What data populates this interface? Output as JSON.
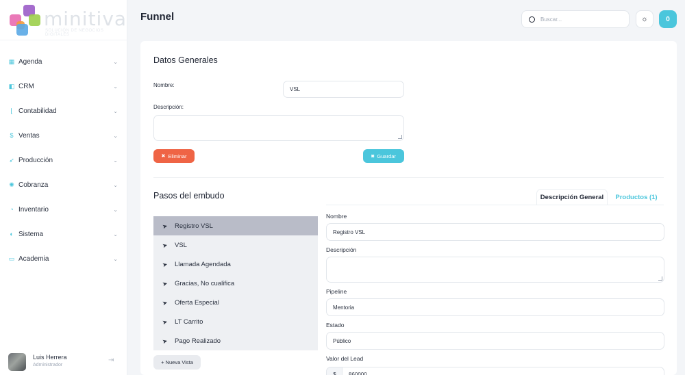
{
  "brand": {
    "name": "minitiva",
    "tagline": "SOLUCIÓN DE NEGOCIOS DIGITALES",
    "colors": {
      "purple": "#9b5cc8",
      "pink": "#e86ab0",
      "green": "#9ccf4a",
      "orange": "#f19a3e",
      "blue": "#5aa9e6"
    }
  },
  "sidebar": {
    "items": [
      {
        "label": "Agenda",
        "icon": "calendar-icon",
        "glyph": "▦",
        "color": "#4bc6dc"
      },
      {
        "label": "CRM",
        "icon": "book-icon",
        "glyph": "◧",
        "color": "#4bc6dc"
      },
      {
        "label": "Contabilidad",
        "icon": "chart-line-icon",
        "glyph": "⌊",
        "color": "#4bc6dc"
      },
      {
        "label": "Ventas",
        "icon": "dollar-icon",
        "glyph": "$",
        "color": "#4bc6dc"
      },
      {
        "label": "Producción",
        "icon": "rocket-icon",
        "glyph": "➶",
        "color": "#4bc6dc"
      },
      {
        "label": "Cobranza",
        "icon": "atom-icon",
        "glyph": "✺",
        "color": "#4bc6dc"
      },
      {
        "label": "Inventario",
        "icon": "spinner-icon",
        "glyph": "◔",
        "color": "#4bc6dc"
      },
      {
        "label": "Sistema",
        "icon": "settings-icon",
        "glyph": "◐",
        "color": "#4bc6dc"
      },
      {
        "label": "Academia",
        "icon": "laptop-icon",
        "glyph": "▭",
        "color": "#4bc6dc"
      }
    ],
    "user": {
      "name": "Luis Herrera",
      "role": "Administrador"
    }
  },
  "header": {
    "title": "Funnel",
    "search_placeholder": "Buscar...",
    "notification_count": "0",
    "accent": "#4bc6dc"
  },
  "general": {
    "heading": "Datos Generales",
    "name_label": "Nombre:",
    "name_value": "VSL",
    "description_label": "Descripción:",
    "delete_label": "Eliminar",
    "save_label": "Guardar",
    "delete_color": "#ef6445"
  },
  "steps": {
    "heading": "Pasos del embudo",
    "items": [
      "Registro VSL",
      "VSL",
      "Llamada Agendada",
      "Gracias, No cualifica",
      "Oferta Especial",
      "LT Carrito",
      "Pago Realizado"
    ],
    "active_index": 0,
    "new_view_label": "+ Nueva Vista"
  },
  "tabs": {
    "general": "Descripción General",
    "products": "Productos (1)"
  },
  "detail": {
    "name_label": "Nombre",
    "name_value": "Registro VSL",
    "description_label": "Descripción",
    "pipeline_label": "Pipeline",
    "pipeline_value": "Mentoria",
    "status_label": "Estado",
    "status_value": "Público",
    "lead_value_label": "Valor del Lead",
    "lead_currency": "$",
    "lead_value": "860000"
  }
}
